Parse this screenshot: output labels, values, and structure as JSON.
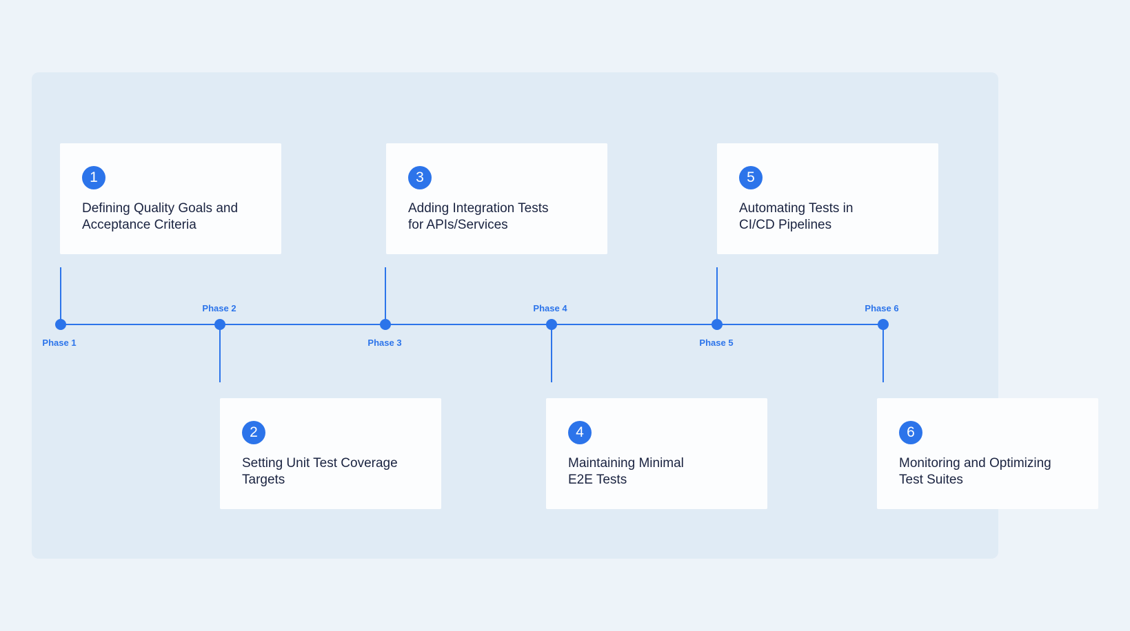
{
  "colors": {
    "page_background": "#edf3f9",
    "panel_background": "#e0ebf5",
    "accent": "#2c74ea",
    "card_background": "#fcfdfe",
    "title_text": "#1a2340"
  },
  "phases": [
    {
      "number": "1",
      "label": "Phase 1",
      "title": "Defining Quality Goals and\nAcceptance Criteria"
    },
    {
      "number": "2",
      "label": "Phase 2",
      "title": "Setting Unit Test Coverage\nTargets"
    },
    {
      "number": "3",
      "label": "Phase 3",
      "title": "Adding Integration Tests\nfor APIs/Services"
    },
    {
      "number": "4",
      "label": "Phase 4",
      "title": "Maintaining Minimal\nE2E Tests"
    },
    {
      "number": "5",
      "label": "Phase 5",
      "title": "Automating Tests in\nCI/CD Pipelines"
    },
    {
      "number": "6",
      "label": "Phase 6",
      "title": "Monitoring and Optimizing\nTest Suites"
    }
  ]
}
